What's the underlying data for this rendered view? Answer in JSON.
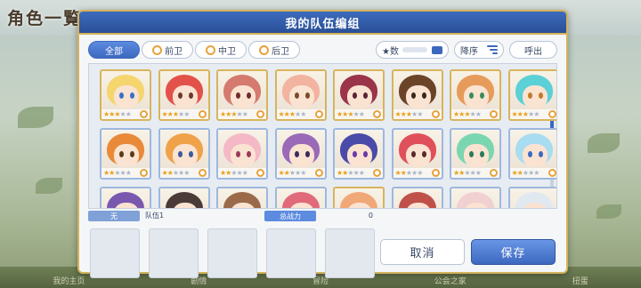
{
  "background": {
    "title": "角色一覧",
    "bottom_nav": [
      "我的主页",
      "剧情",
      "冒险",
      "公会之家",
      "扭蛋"
    ]
  },
  "dialog": {
    "title": "我的队伍编组"
  },
  "filter": {
    "tabs": [
      {
        "label": "全部",
        "active": true
      },
      {
        "label": "前卫",
        "active": false
      },
      {
        "label": "中卫",
        "active": false
      },
      {
        "label": "后卫",
        "active": false
      }
    ],
    "sort_field": "★数",
    "sort_order": "降序",
    "call_button": "呼出"
  },
  "roster": {
    "cards": [
      {
        "hair": "#f4d56e",
        "eye": "#3a6fc4",
        "frame": "gold",
        "stars": 3
      },
      {
        "hair": "#e2524a",
        "eye": "#6d3a2a",
        "frame": "gold",
        "stars": 3
      },
      {
        "hair": "#d47a6e",
        "eye": "#6d2d2d",
        "frame": "gold",
        "stars": 3
      },
      {
        "hair": "#f2b3a0",
        "eye": "#7a4d2a",
        "frame": "gold",
        "stars": 3
      },
      {
        "hair": "#9b3449",
        "eye": "#5a2233",
        "frame": "gold",
        "stars": 3
      },
      {
        "hair": "#6b4428",
        "eye": "#3a2618",
        "frame": "gold",
        "stars": 3
      },
      {
        "hair": "#e79b5a",
        "eye": "#3a8c5a",
        "frame": "gold",
        "stars": 3
      },
      {
        "hair": "#5bd0d6",
        "eye": "#c47a2a",
        "frame": "gold",
        "stars": 3
      },
      {
        "hair": "#e88a3a",
        "eye": "#5a3a1a",
        "frame": "blue",
        "stars": 2
      },
      {
        "hair": "#f0a24a",
        "eye": "#3a5a9a",
        "frame": "blue",
        "stars": 2
      },
      {
        "hair": "#f4b8c6",
        "eye": "#9a3a5a",
        "frame": "blue",
        "stars": 2
      },
      {
        "hair": "#9a6ab8",
        "eye": "#3a2a5a",
        "frame": "blue",
        "stars": 2
      },
      {
        "hair": "#4a4aa8",
        "eye": "#6a3aa8",
        "frame": "blue",
        "stars": 2
      },
      {
        "hair": "#e0505a",
        "eye": "#5a2a2a",
        "frame": "blue",
        "stars": 2
      },
      {
        "hair": "#7ad6b0",
        "eye": "#2a7a5a",
        "frame": "blue",
        "stars": 2
      },
      {
        "hair": "#a8dcf0",
        "eye": "#3a6ac4",
        "frame": "blue",
        "stars": 2
      },
      {
        "hair": "#7a58b0",
        "eye": "#3a2a5a",
        "frame": "blue",
        "stars": 0
      },
      {
        "hair": "#4a3a38",
        "eye": "#2a2a2a",
        "frame": "blue",
        "stars": 0
      },
      {
        "hair": "#9a6a4a",
        "eye": "#4a2a1a",
        "frame": "blue",
        "stars": 0
      },
      {
        "hair": "#e06a7a",
        "eye": "#5a2a2a",
        "frame": "blue",
        "stars": 0
      },
      {
        "hair": "#f0a878",
        "eye": "#5a3a2a",
        "frame": "gold",
        "stars": 0
      },
      {
        "hair": "#c0504a",
        "eye": "#4a2a2a",
        "frame": "blue",
        "stars": 0
      },
      {
        "hair": "#f0d0d0",
        "eye": "#8a4a5a",
        "frame": "blue",
        "stars": 0
      },
      {
        "hair": "#e0e8f0",
        "eye": "#4a6a8a",
        "frame": "blue",
        "stars": 0
      }
    ]
  },
  "team": {
    "left_label": "无",
    "name": "队伍1",
    "power_label": "总战力",
    "power_value": "0",
    "slots": 5
  },
  "buttons": {
    "cancel": "取消",
    "save": "保存"
  }
}
